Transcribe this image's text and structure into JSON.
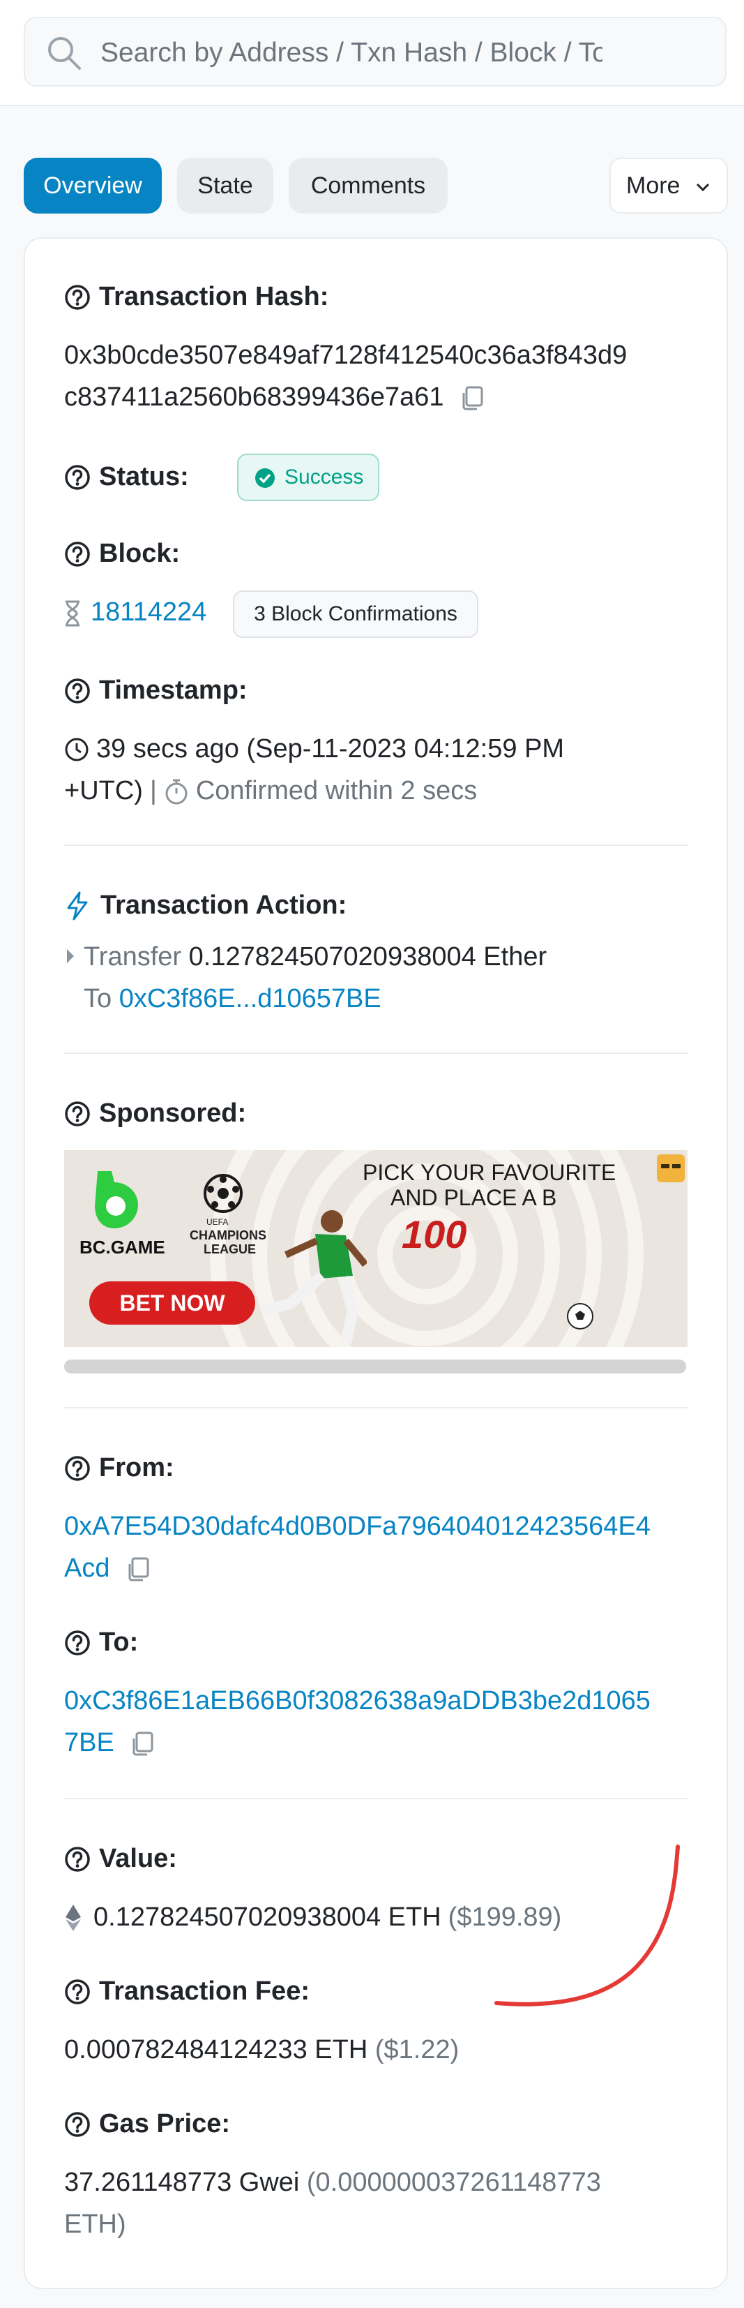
{
  "search": {
    "placeholder": "Search by Address / Txn Hash / Block / Token / Domain Name"
  },
  "tabs": [
    {
      "label": "Overview",
      "active": true
    },
    {
      "label": "State",
      "active": false
    },
    {
      "label": "Comments",
      "active": false
    }
  ],
  "more_label": "More",
  "tx": {
    "hash_label": "Transaction Hash:",
    "hash_line1": "0x3b0cde3507e849af7128f412540c36a3f843d9",
    "hash_line2": "c837411a2560b68399436e7a61",
    "status_label": "Status:",
    "status_value": "Success",
    "block_label": "Block:",
    "block_number": "18114224",
    "block_confirmations": "3 Block Confirmations",
    "timestamp_label": "Timestamp:",
    "timestamp_line1": "39 secs ago (Sep-11-2023 04:12:59 PM",
    "timestamp_line2": "+UTC)",
    "timestamp_sep": "|",
    "confirmed_within": "Confirmed within 2 secs",
    "action_label": "Transaction Action:",
    "action_verb": "Transfer",
    "action_amount": "0.127824507020938004 Ether",
    "action_to_word": "To",
    "action_to_addr": "0xC3f86E...d10657BE",
    "sponsored_label": "Sponsored:",
    "from_label": "From:",
    "from_line1": "0xA7E54D30dafc4d0B0DFa796404012423564E4",
    "from_line2": "Acd",
    "to_label": "To:",
    "to_line1": "0xC3f86E1aEB66B0f3082638a9aDDB3be2d1065",
    "to_line2": "7BE",
    "value_label": "Value:",
    "value_eth": "0.127824507020938004 ETH",
    "value_usd": "($199.89)",
    "fee_label": "Transaction Fee:",
    "fee_eth": "0.000782484124233 ETH",
    "fee_usd": "($1.22)",
    "gas_label": "Gas Price:",
    "gas_gwei": "37.261148773 Gwei",
    "gas_eth_line1": "(0.000000037261148773",
    "gas_eth_line2": "ETH)"
  },
  "ad": {
    "brand": "BC.GAME",
    "league_line1": "UEFA",
    "league_line2": "CHAMPIONS",
    "league_line3": "LEAGUE",
    "headline_line1": "PICK YOUR FAVOURITE",
    "headline_line2": "AND PLACE A B",
    "amount": "100",
    "cta": "BET NOW"
  },
  "colors": {
    "link": "#0784c3",
    "success": "#00a186",
    "annotation": "#e53935",
    "ad_cta": "#d71f1f",
    "brand_green": "#2ecc40"
  },
  "icons": [
    "search-icon",
    "help-circle-icon",
    "copy-icon",
    "check-circle-icon",
    "hourglass-icon",
    "clock-icon",
    "stopwatch-icon",
    "lightning-icon",
    "caret-right-icon",
    "ethereum-icon",
    "chevron-down-icon"
  ]
}
